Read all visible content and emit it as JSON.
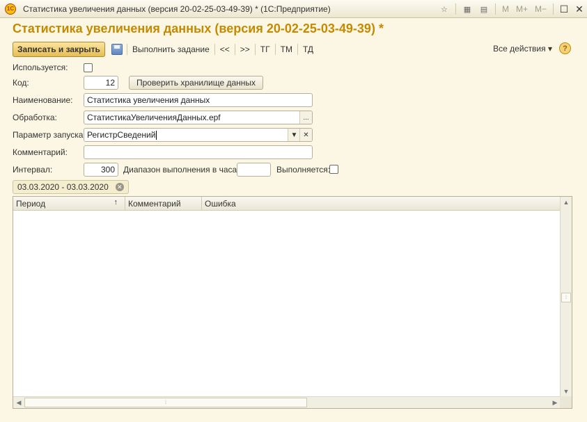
{
  "window": {
    "app_icon_text": "1С",
    "title": "Статистика увеличения данных (версия 20-02-25-03-49-39) *  (1С:Предприятие)",
    "tool_m": "M",
    "tool_mplus": "M+",
    "tool_mminus": "M−"
  },
  "form": {
    "heading": "Статистика увеличения данных (версия 20-02-25-03-49-39) *"
  },
  "toolbar": {
    "save_close": "Записать и закрыть",
    "run_task": "Выполнить задание",
    "prev": "<<",
    "next": ">>",
    "tg": "ТГ",
    "tm": "ТМ",
    "td": "ТД",
    "all_actions": "Все действия ▾",
    "help": "?"
  },
  "fields": {
    "used_label": "Используется:",
    "code_label": "Код:",
    "code_value": "12",
    "check_storage_button": "Проверить хранилище данных",
    "name_label": "Наименование:",
    "name_value": "Статистика увеличения данных",
    "processing_label": "Обработка:",
    "processing_value": "СтатистикаУвеличенияДанных.epf",
    "processing_button": "...",
    "param_label": "Параметр запуска:",
    "param_value": "РегистрСведений",
    "comment_label": "Комментарий:",
    "comment_value": "",
    "interval_label": "Интервал:",
    "interval_value": "300",
    "range_label": "Диапазон выполнения в часах:",
    "range_value": "",
    "running_label": "Выполняется:"
  },
  "filter": {
    "period": "03.03.2020 - 03.03.2020"
  },
  "table": {
    "columns": [
      "Период",
      "Комментарий",
      "Ошибка"
    ],
    "sort_indicator": "↑",
    "rows": []
  }
}
